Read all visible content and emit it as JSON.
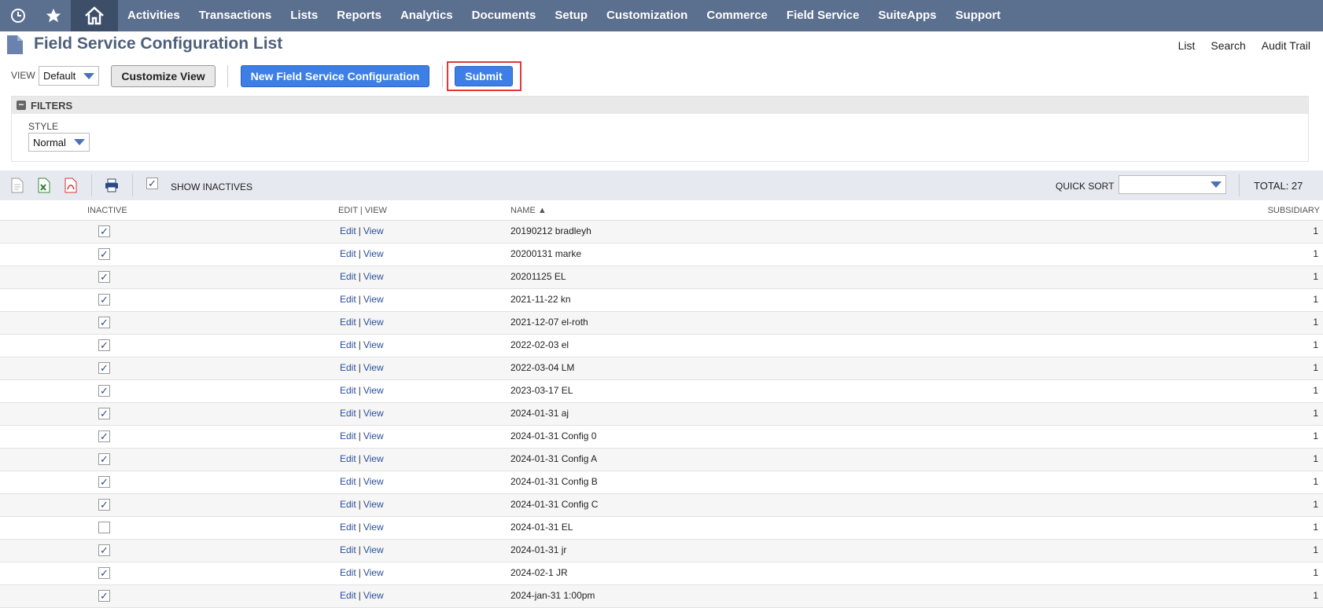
{
  "nav": {
    "items": [
      "Activities",
      "Transactions",
      "Lists",
      "Reports",
      "Analytics",
      "Documents",
      "Setup",
      "Customization",
      "Commerce",
      "Field Service",
      "SuiteApps",
      "Support"
    ]
  },
  "page": {
    "title": "Field Service Configuration List",
    "links": [
      "List",
      "Search",
      "Audit Trail"
    ]
  },
  "toolbar": {
    "view_label": "VIEW",
    "view_value": "Default",
    "customize_label": "Customize View",
    "new_label": "New Field Service Configuration",
    "submit_label": "Submit"
  },
  "filters": {
    "header": "FILTERS",
    "style_label": "STYLE",
    "style_value": "Normal"
  },
  "listbar": {
    "show_inactives": "SHOW INACTIVES",
    "quick_sort_label": "QUICK SORT",
    "total": "TOTAL: 27"
  },
  "table": {
    "headers": [
      "INACTIVE",
      "EDIT | VIEW",
      "NAME ▲",
      "SUBSIDIARY"
    ],
    "edit": "Edit",
    "view": "View",
    "rows": [
      {
        "inactive": true,
        "name": "20190212 bradleyh",
        "subsidiary": "1"
      },
      {
        "inactive": true,
        "name": "20200131 marke",
        "subsidiary": "1"
      },
      {
        "inactive": true,
        "name": "20201125 EL",
        "subsidiary": "1"
      },
      {
        "inactive": true,
        "name": "2021-11-22 kn",
        "subsidiary": "1"
      },
      {
        "inactive": true,
        "name": "2021-12-07 el-roth",
        "subsidiary": "1"
      },
      {
        "inactive": true,
        "name": "2022-02-03 el",
        "subsidiary": "1"
      },
      {
        "inactive": true,
        "name": "2022-03-04 LM",
        "subsidiary": "1"
      },
      {
        "inactive": true,
        "name": "2023-03-17 EL",
        "subsidiary": "1"
      },
      {
        "inactive": true,
        "name": "2024-01-31 aj",
        "subsidiary": "1"
      },
      {
        "inactive": true,
        "name": "2024-01-31 Config 0",
        "subsidiary": "1"
      },
      {
        "inactive": true,
        "name": "2024-01-31 Config A",
        "subsidiary": "1"
      },
      {
        "inactive": true,
        "name": "2024-01-31 Config B",
        "subsidiary": "1"
      },
      {
        "inactive": true,
        "name": "2024-01-31 Config C",
        "subsidiary": "1"
      },
      {
        "inactive": false,
        "name": "2024-01-31 EL",
        "subsidiary": "1"
      },
      {
        "inactive": true,
        "name": "2024-01-31 jr",
        "subsidiary": "1"
      },
      {
        "inactive": true,
        "name": "2024-02-1 JR",
        "subsidiary": "1"
      },
      {
        "inactive": true,
        "name": "2024-jan-31 1:00pm",
        "subsidiary": "1"
      }
    ]
  }
}
